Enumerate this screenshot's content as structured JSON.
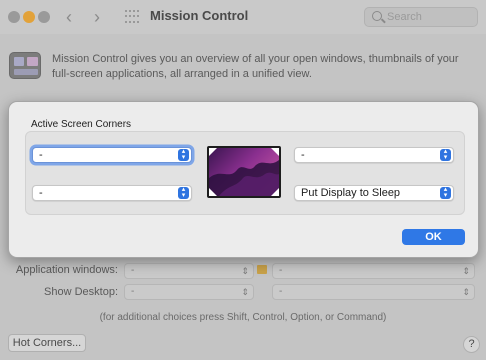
{
  "window": {
    "title": "Mission Control",
    "search_placeholder": "Search",
    "description": "Mission Control gives you an overview of all your open windows, thumbnails of your full-screen applications, all arranged in a unified view."
  },
  "background_form": {
    "app_windows_label": "Application windows:",
    "app_windows_left_value": "-",
    "app_windows_right_value": "-",
    "show_desktop_label": "Show Desktop:",
    "show_desktop_left_value": "-",
    "show_desktop_right_value": "-",
    "hint": "(for additional choices press Shift, Control, Option, or Command)",
    "hot_corners_button": "Hot Corners...",
    "help_button": "?"
  },
  "sheet": {
    "group_label": "Active Screen Corners",
    "corners": {
      "top_left": "-",
      "top_right": "-",
      "bottom_left": "-",
      "bottom_right": "Put Display to Sleep"
    },
    "ok_label": "OK"
  },
  "colors": {
    "accent": "#2f78e6",
    "focus_ring": "#7fa6e8",
    "sheet_bg": "#ececec"
  }
}
